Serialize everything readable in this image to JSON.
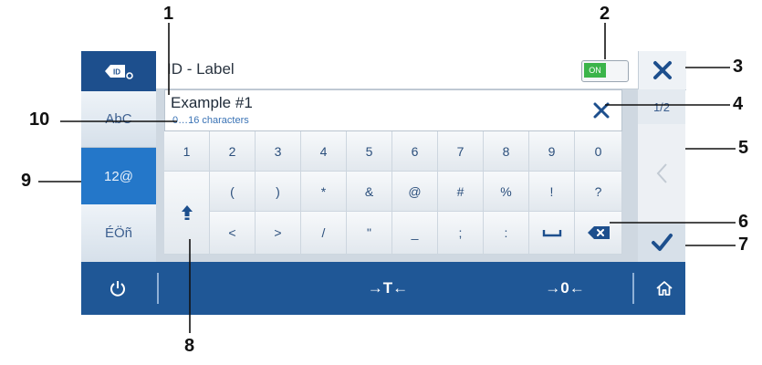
{
  "title_bar": {
    "title": "ID - Label",
    "toggle_label": "ON"
  },
  "input": {
    "value": "Example #1",
    "hint": "0…16 characters"
  },
  "modes": {
    "abc": "AbC",
    "numeric": "12@",
    "accented": "ÉÖñ"
  },
  "keyboard": {
    "row1": [
      "1",
      "2",
      "3",
      "4",
      "5",
      "6",
      "7",
      "8",
      "9",
      "0"
    ],
    "row2": [
      "(",
      ")",
      "*",
      "&",
      "@",
      "#",
      "%",
      "!",
      "?"
    ],
    "row3": [
      "<",
      ">",
      "/",
      "\"",
      "_",
      ";",
      ":"
    ]
  },
  "right": {
    "page_indicator": "1/2"
  },
  "bottom_bar": {
    "tare": "→T←",
    "zero": "→0←"
  },
  "callouts": [
    "1",
    "2",
    "3",
    "4",
    "5",
    "6",
    "7",
    "8",
    "9",
    "10"
  ],
  "colors": {
    "accent": "#2477c9",
    "bar": "#1f5796",
    "on": "#3bb44a"
  }
}
